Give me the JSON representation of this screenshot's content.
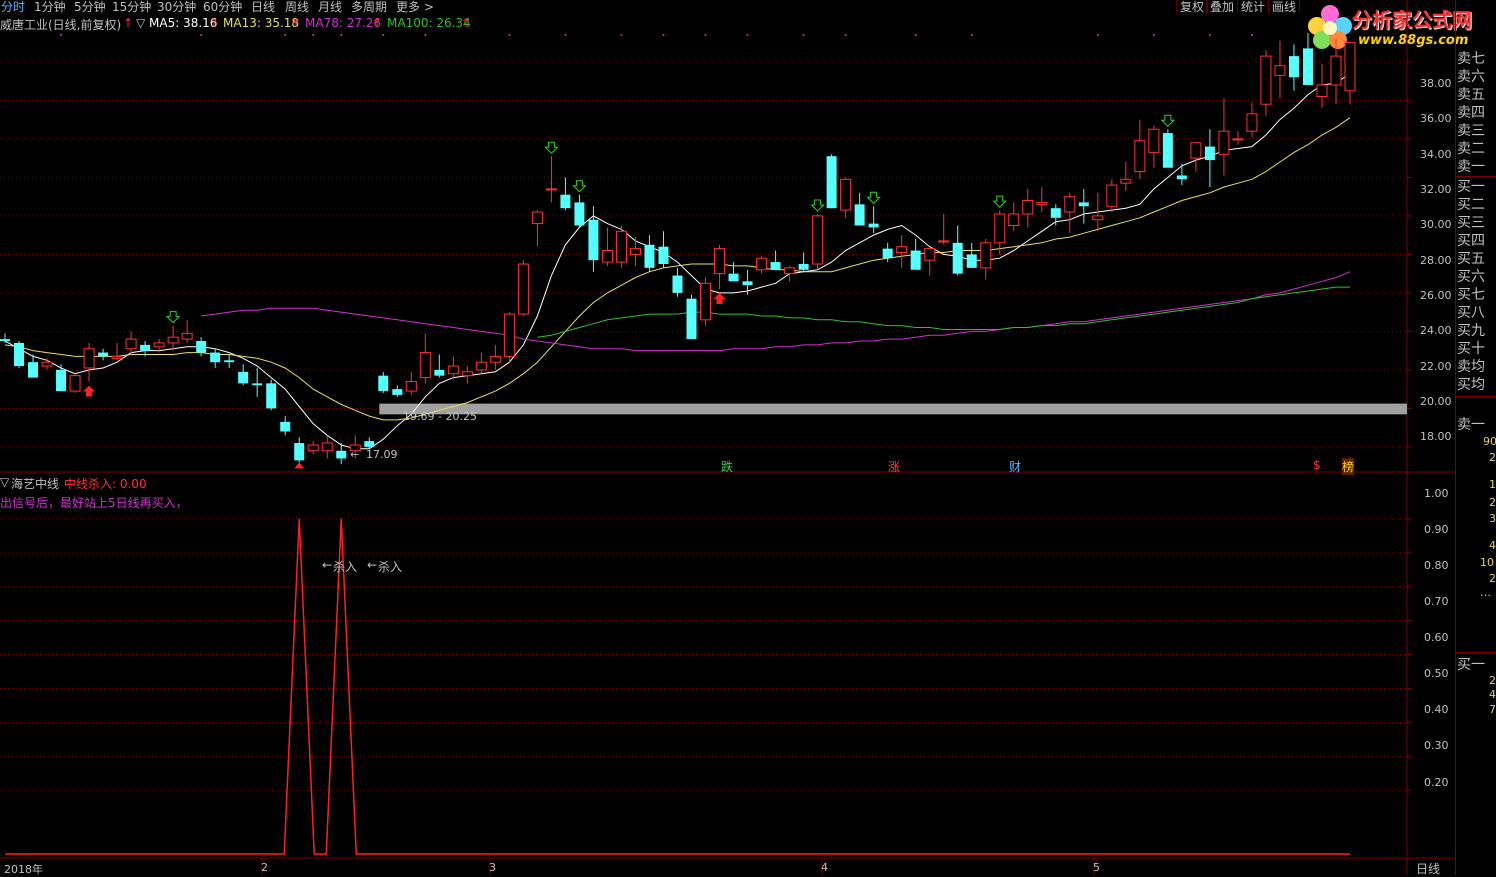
{
  "toolbar": {
    "timeframes": [
      "分时",
      "1分钟",
      "5分钟",
      "15分钟",
      "30分钟",
      "60分钟",
      "日线",
      "周线",
      "月线",
      "多周期",
      "更多 >"
    ],
    "buttons": [
      "复权",
      "叠加",
      "统计",
      "画线"
    ]
  },
  "logo": {
    "name": "分析家公式网",
    "url": "www.88gs.com"
  },
  "main_header": {
    "title": "威唐工业(日线,前复权)",
    "ma5": "MA5: 38.16",
    "ma13": "MA13: 35.18",
    "ma78": "MA78: 27.26",
    "ma100": "MA100: 26.34"
  },
  "sub_header": {
    "name": "海艺中线",
    "value": "中线杀入: 0.00",
    "tip": "出信号后，最好站上5日线再买入，"
  },
  "annotations": {
    "range": "19.69 - 20.25",
    "low": "17.09",
    "kill1": "杀入",
    "kill2": "杀入",
    "events": [
      "跌",
      "涨",
      "财",
      "$",
      "榜"
    ]
  },
  "y_axis_main": [
    "38.00",
    "36.00",
    "34.00",
    "32.00",
    "30.00",
    "28.00",
    "26.00",
    "24.00",
    "22.00",
    "20.00",
    "18.00"
  ],
  "y_axis_sub": [
    "1.00",
    "0.90",
    "0.80",
    "0.70",
    "0.60",
    "0.50",
    "0.40",
    "0.30",
    "0.20"
  ],
  "x_axis": [
    "2018年",
    "2",
    "3",
    "4",
    "5"
  ],
  "period_label": "日线",
  "order_book": {
    "asks": [
      "卖七",
      "卖六",
      "卖五",
      "卖四",
      "卖三",
      "卖二",
      "卖一"
    ],
    "bids": [
      "买一",
      "买二",
      "买三",
      "买四",
      "买五",
      "买六",
      "买七",
      "买八",
      "买九",
      "买十"
    ],
    "avg": [
      "卖均",
      "买均"
    ],
    "sell1": "卖一",
    "buy1": "买一",
    "side_numbers_1": [
      "90",
      "2",
      "1",
      "2",
      "3",
      "4",
      "10",
      "2"
    ],
    "side_numbers_2": [
      "2",
      "4",
      "7"
    ]
  },
  "colors": {
    "up": "#ff3232",
    "down": "#54ffff",
    "ma5": "#ffffff",
    "ma13": "#e8e060",
    "ma78": "#d030d0",
    "ma100": "#30c030",
    "grid": "#800000"
  },
  "chart_data": {
    "type": "candlestick",
    "title": "威唐工业(日线,前复权)",
    "ylim": [
      16.8,
      39.5
    ],
    "candles": [
      [
        23.6,
        23.9,
        23.4,
        23.5
      ],
      [
        23.4,
        23.5,
        22.1,
        22.2
      ],
      [
        22.4,
        22.8,
        22.0,
        21.6
      ],
      [
        22.2,
        22.6,
        22.0,
        22.4
      ],
      [
        22.0,
        22.3,
        20.9,
        20.9
      ],
      [
        20.9,
        21.8,
        20.8,
        21.7
      ],
      [
        22.1,
        23.4,
        21.4,
        23.1
      ],
      [
        22.9,
        23.1,
        22.5,
        22.7
      ],
      [
        22.6,
        23.4,
        22.5,
        22.7
      ],
      [
        23.1,
        24.0,
        22.8,
        23.6
      ],
      [
        23.3,
        23.5,
        22.7,
        23.0
      ],
      [
        23.2,
        23.6,
        22.9,
        23.4
      ],
      [
        23.4,
        24.3,
        23.0,
        23.7
      ],
      [
        23.6,
        24.6,
        23.4,
        23.9
      ],
      [
        23.5,
        23.7,
        22.7,
        22.9
      ],
      [
        22.9,
        23.1,
        22.1,
        22.4
      ],
      [
        22.5,
        22.8,
        22.1,
        22.4
      ],
      [
        21.9,
        22.3,
        21.2,
        21.3
      ],
      [
        21.3,
        22.1,
        20.6,
        21.2
      ],
      [
        21.3,
        21.5,
        19.9,
        20.0
      ],
      [
        19.3,
        19.6,
        18.6,
        18.8
      ],
      [
        18.2,
        18.5,
        17.2,
        17.3
      ],
      [
        17.8,
        18.3,
        17.6,
        18.1
      ],
      [
        17.8,
        18.6,
        17.4,
        18.2
      ],
      [
        17.8,
        18.2,
        17.1,
        17.4
      ],
      [
        17.8,
        18.6,
        17.4,
        18.1
      ],
      [
        18.3,
        18.5,
        17.9,
        18.0
      ],
      [
        21.7,
        21.9,
        20.8,
        20.9
      ],
      [
        21.0,
        21.2,
        20.6,
        20.7
      ],
      [
        20.9,
        21.9,
        20.7,
        21.4
      ],
      [
        21.6,
        23.9,
        21.3,
        22.9
      ],
      [
        22.0,
        22.8,
        21.6,
        21.7
      ],
      [
        21.8,
        22.7,
        21.5,
        22.2
      ],
      [
        21.7,
        22.2,
        21.3,
        21.9
      ],
      [
        22.0,
        22.9,
        21.8,
        22.4
      ],
      [
        22.4,
        23.3,
        22.0,
        22.7
      ],
      [
        22.7,
        25.0,
        22.4,
        24.9
      ],
      [
        24.9,
        27.7,
        24.8,
        27.5
      ],
      [
        29.6,
        30.3,
        28.4,
        30.2
      ],
      [
        31.4,
        33.1,
        30.7,
        31.4
      ],
      [
        31.1,
        32.0,
        30.3,
        30.4
      ],
      [
        30.7,
        31.1,
        29.4,
        29.5
      ],
      [
        29.8,
        30.5,
        27.1,
        27.7
      ],
      [
        27.6,
        29.4,
        27.4,
        28.2
      ],
      [
        27.6,
        29.5,
        27.3,
        29.2
      ],
      [
        28.0,
        28.9,
        27.4,
        28.3
      ],
      [
        28.5,
        29.0,
        27.1,
        27.3
      ],
      [
        28.4,
        29.2,
        27.3,
        27.5
      ],
      [
        26.9,
        27.3,
        25.8,
        26.0
      ],
      [
        25.7,
        25.9,
        23.9,
        23.6
      ],
      [
        24.6,
        26.8,
        24.3,
        26.5
      ],
      [
        27.0,
        28.5,
        26.2,
        28.3
      ],
      [
        27.0,
        27.6,
        26.7,
        26.6
      ],
      [
        26.6,
        27.2,
        25.9,
        26.4
      ],
      [
        27.2,
        27.9,
        27.0,
        27.8
      ],
      [
        27.6,
        28.2,
        27.2,
        27.2
      ],
      [
        27.0,
        27.4,
        26.6,
        27.3
      ],
      [
        27.5,
        28.1,
        27.1,
        27.2
      ],
      [
        27.5,
        30.1,
        27.2,
        30.0
      ],
      [
        33.1,
        33.2,
        30.4,
        30.4
      ],
      [
        30.3,
        32.0,
        29.9,
        31.9
      ],
      [
        30.6,
        31.2,
        29.7,
        29.5
      ],
      [
        29.6,
        30.5,
        29.1,
        29.4
      ],
      [
        28.3,
        28.6,
        27.6,
        27.8
      ],
      [
        28.1,
        29.0,
        27.3,
        28.4
      ],
      [
        28.2,
        28.8,
        27.6,
        27.2
      ],
      [
        27.7,
        28.3,
        26.9,
        28.3
      ],
      [
        28.7,
        30.1,
        28.5,
        28.7
      ],
      [
        28.6,
        29.5,
        26.9,
        27.0
      ],
      [
        28.0,
        28.6,
        27.6,
        27.3
      ],
      [
        27.3,
        28.8,
        26.7,
        28.6
      ],
      [
        28.6,
        30.3,
        28.0,
        30.1
      ],
      [
        29.5,
        30.7,
        29.2,
        30.1
      ],
      [
        30.1,
        31.4,
        29.4,
        30.8
      ],
      [
        30.6,
        31.5,
        30.2,
        30.7
      ],
      [
        30.4,
        30.6,
        29.5,
        29.9
      ],
      [
        30.2,
        31.2,
        29.1,
        31.0
      ],
      [
        30.7,
        31.4,
        29.6,
        30.5
      ],
      [
        29.8,
        31.2,
        29.2,
        30.0
      ],
      [
        30.5,
        31.9,
        30.2,
        31.6
      ],
      [
        31.7,
        32.8,
        31.3,
        31.9
      ],
      [
        32.3,
        35.0,
        31.9,
        33.9
      ],
      [
        33.3,
        34.7,
        32.5,
        34.5
      ],
      [
        34.3,
        34.5,
        32.9,
        32.5
      ],
      [
        32.1,
        32.7,
        31.6,
        31.9
      ],
      [
        33.0,
        33.6,
        32.3,
        33.8
      ],
      [
        33.6,
        34.5,
        31.5,
        32.9
      ],
      [
        33.2,
        36.1,
        32.1,
        34.4
      ],
      [
        34.0,
        34.4,
        33.7,
        34.0
      ],
      [
        34.4,
        35.9,
        34.1,
        35.3
      ],
      [
        35.8,
        38.6,
        35.2,
        38.3
      ],
      [
        37.3,
        39.1,
        36.1,
        37.8
      ],
      [
        38.3,
        38.9,
        36.5,
        37.2
      ],
      [
        38.7,
        39.5,
        37.0,
        36.8
      ],
      [
        36.2,
        37.9,
        35.6,
        36.8
      ],
      [
        36.8,
        39.2,
        35.8,
        38.3
      ],
      [
        36.5,
        38.8,
        35.8,
        39.0
      ]
    ],
    "series": [
      {
        "name": "MA5",
        "values": [
          23.5,
          23.1,
          22.7,
          22.5,
          22.1,
          21.8,
          22.0,
          22.1,
          22.4,
          22.9,
          23.0,
          23.0,
          23.1,
          23.2,
          23.2,
          23.1,
          22.9,
          22.6,
          22.2,
          21.6,
          21.0,
          20.1,
          19.2,
          18.6,
          18.1,
          17.9,
          17.9,
          18.4,
          19.1,
          19.7,
          20.6,
          21.3,
          21.6,
          21.7,
          21.8,
          21.9,
          22.4,
          23.3,
          24.8,
          26.9,
          28.5,
          29.4,
          30.0,
          29.6,
          29.3,
          28.7,
          28.4,
          28.1,
          27.6,
          26.9,
          26.2,
          26.0,
          26.0,
          26.1,
          26.3,
          26.5,
          27.0,
          27.1,
          27.2,
          27.6,
          28.2,
          28.6,
          29.0,
          29.3,
          29.5,
          29.0,
          28.4,
          28.0,
          27.9,
          27.7,
          27.7,
          27.8,
          28.2,
          28.7,
          29.2,
          29.7,
          29.8,
          30.1,
          30.2,
          30.3,
          30.4,
          30.6,
          31.4,
          32.0,
          32.6,
          32.9,
          33.1,
          33.4,
          33.5,
          33.6,
          34.2,
          35.0,
          35.6,
          36.3,
          36.8,
          36.9,
          37.4
        ]
      },
      {
        "name": "MA13",
        "values": [
          23.3,
          23.2,
          23.0,
          22.9,
          22.8,
          22.7,
          22.7,
          22.7,
          22.7,
          22.8,
          22.8,
          22.8,
          22.8,
          22.9,
          22.9,
          22.8,
          22.8,
          22.7,
          22.6,
          22.4,
          22.1,
          21.6,
          21.0,
          20.6,
          20.2,
          19.9,
          19.6,
          19.4,
          19.4,
          19.5,
          19.7,
          19.9,
          20.1,
          20.3,
          20.6,
          20.9,
          21.3,
          21.8,
          22.4,
          23.2,
          24.0,
          24.8,
          25.5,
          26.0,
          26.4,
          26.8,
          27.1,
          27.3,
          27.4,
          27.5,
          27.5,
          27.5,
          27.4,
          27.4,
          27.3,
          27.2,
          27.2,
          27.1,
          27.1,
          27.1,
          27.3,
          27.5,
          27.7,
          27.8,
          27.9,
          28.0,
          28.1,
          28.1,
          28.2,
          28.2,
          28.2,
          28.3,
          28.4,
          28.5,
          28.6,
          28.8,
          28.9,
          29.1,
          29.3,
          29.5,
          29.7,
          29.9,
          30.2,
          30.5,
          30.8,
          31.0,
          31.2,
          31.5,
          31.7,
          31.9,
          32.3,
          32.8,
          33.3,
          33.7,
          34.2,
          34.6,
          35.1
        ]
      },
      {
        "name": "MA78",
        "values": [
          null,
          null,
          null,
          null,
          null,
          null,
          null,
          null,
          null,
          null,
          null,
          null,
          null,
          null,
          24.8,
          24.9,
          25.0,
          25.1,
          25.1,
          25.2,
          25.2,
          25.2,
          25.2,
          25.1,
          25.0,
          24.9,
          24.8,
          24.7,
          24.6,
          24.5,
          24.4,
          24.3,
          24.2,
          24.1,
          24.0,
          23.9,
          23.8,
          23.6,
          23.5,
          23.4,
          23.3,
          23.2,
          23.1,
          23.1,
          23.1,
          23.0,
          23.0,
          23.0,
          23.0,
          23.0,
          23.0,
          23.0,
          23.1,
          23.1,
          23.1,
          23.2,
          23.2,
          23.3,
          23.3,
          23.4,
          23.4,
          23.5,
          23.5,
          23.6,
          23.6,
          23.7,
          23.8,
          23.8,
          23.9,
          24.0,
          24.0,
          24.1,
          24.2,
          24.2,
          24.3,
          24.4,
          24.5,
          24.5,
          24.6,
          24.7,
          24.8,
          24.9,
          25.0,
          25.1,
          25.2,
          25.3,
          25.4,
          25.5,
          25.6,
          25.7,
          25.9,
          26.0,
          26.2,
          26.4,
          26.6,
          26.8,
          27.1
        ]
      },
      {
        "name": "MA100",
        "values": [
          null,
          null,
          null,
          null,
          null,
          null,
          null,
          null,
          null,
          null,
          null,
          null,
          null,
          null,
          null,
          null,
          null,
          null,
          null,
          null,
          null,
          null,
          null,
          null,
          null,
          null,
          null,
          null,
          null,
          null,
          null,
          null,
          null,
          null,
          null,
          null,
          null,
          null,
          23.7,
          23.8,
          24.0,
          24.2,
          24.4,
          24.6,
          24.7,
          24.8,
          24.9,
          24.9,
          24.9,
          25.0,
          25.0,
          24.9,
          24.9,
          24.9,
          24.8,
          24.8,
          24.7,
          24.7,
          24.6,
          24.6,
          24.5,
          24.5,
          24.4,
          24.3,
          24.3,
          24.2,
          24.2,
          24.1,
          24.1,
          24.1,
          24.1,
          24.1,
          24.2,
          24.2,
          24.3,
          24.3,
          24.4,
          24.4,
          24.5,
          24.6,
          24.7,
          24.8,
          24.9,
          25.0,
          25.1,
          25.2,
          25.3,
          25.4,
          25.5,
          25.7,
          25.8,
          25.9,
          26.0,
          26.1,
          26.2,
          26.3,
          26.3
        ]
      }
    ],
    "signals_down": [
      12,
      39,
      41,
      58,
      62,
      71,
      83
    ],
    "signals_up": [
      6,
      51
    ],
    "sub_indicator": {
      "name": "中线杀入",
      "spikes": [
        21,
        24
      ],
      "ylim": [
        0,
        1.1
      ]
    }
  }
}
